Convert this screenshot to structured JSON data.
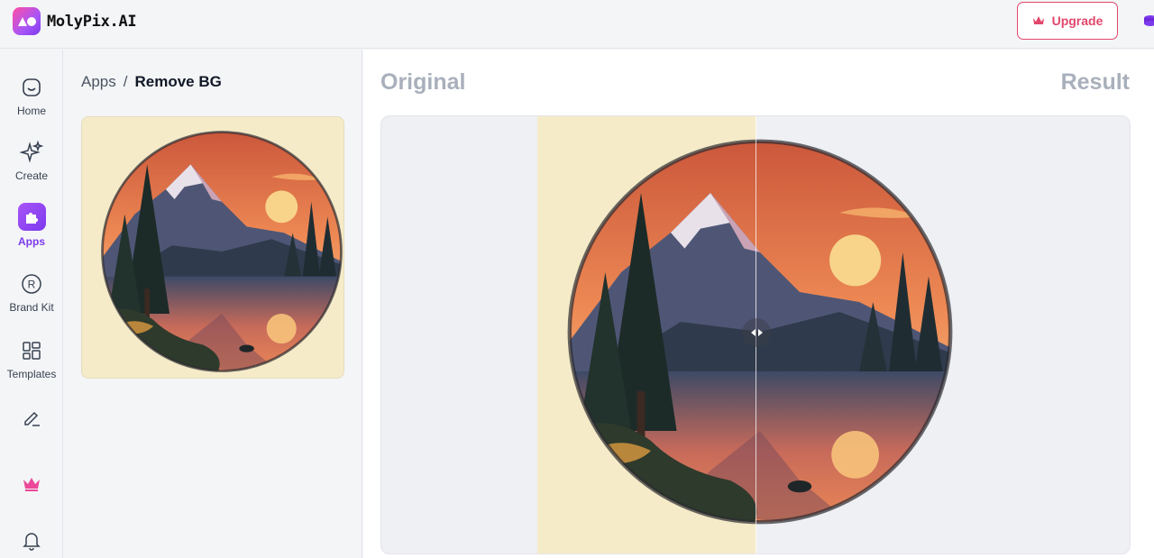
{
  "app": {
    "name": "MolyPix.AI"
  },
  "header": {
    "upgrade_label": "Upgrade"
  },
  "nav": {
    "items": [
      {
        "label": "Home",
        "icon": "home-icon"
      },
      {
        "label": "Create",
        "icon": "sparkle-icon"
      },
      {
        "label": "Apps",
        "icon": "puzzle-icon",
        "active": true
      },
      {
        "label": "Brand Kit",
        "icon": "registered-icon"
      },
      {
        "label": "Templates",
        "icon": "grid-icon"
      },
      {
        "label": "",
        "icon": "pencil-icon"
      },
      {
        "label": "",
        "icon": "crown-icon"
      },
      {
        "label": "",
        "icon": "bell-icon"
      }
    ]
  },
  "breadcrumb": {
    "parent": "Apps",
    "separator": "/",
    "current": "Remove BG"
  },
  "compare": {
    "left_label": "Original",
    "right_label": "Result"
  },
  "colors": {
    "accent": "#7c3aed",
    "upgrade": "#e2476b",
    "cream": "#f5ebc8",
    "sky": "#e8744a"
  }
}
